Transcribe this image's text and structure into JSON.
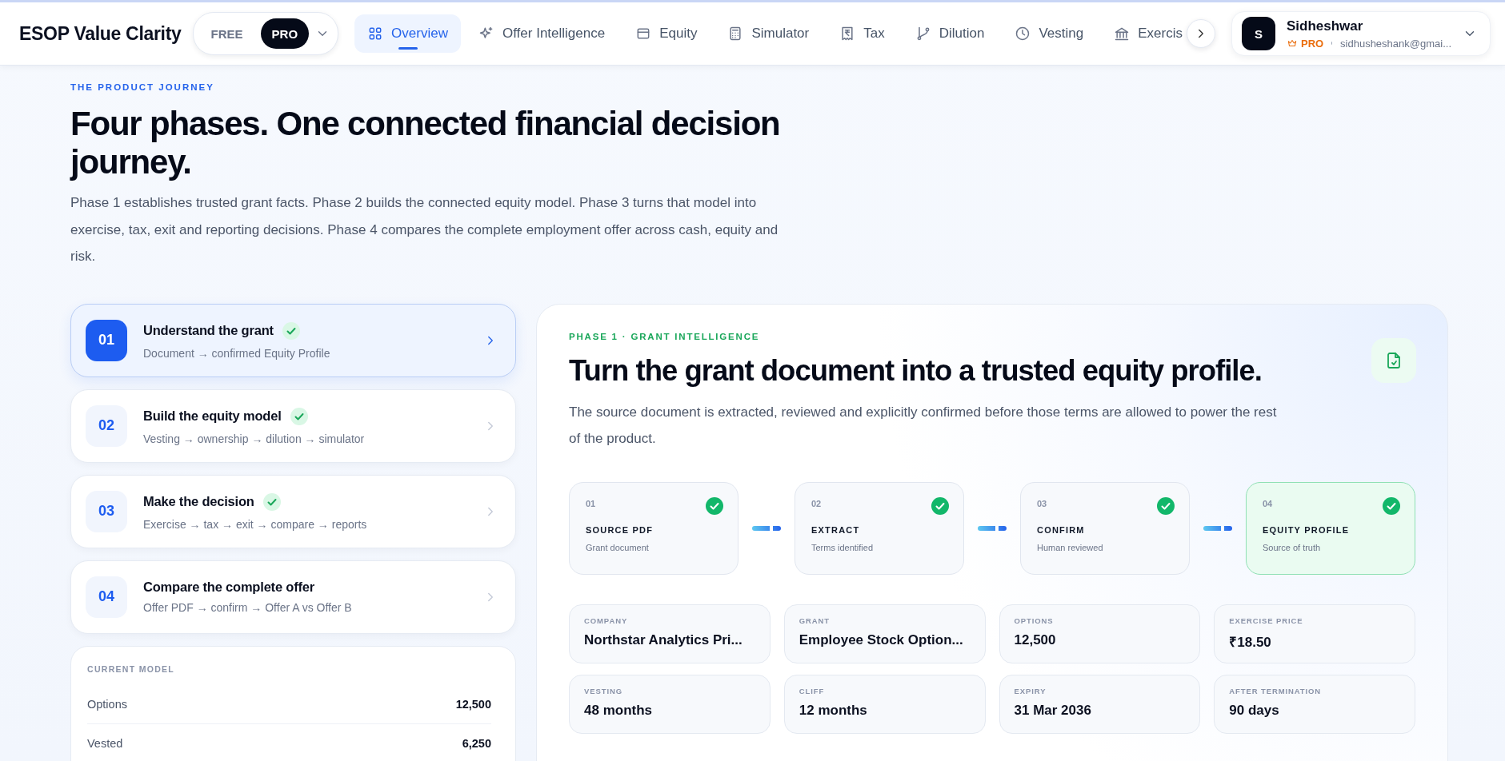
{
  "app": {
    "title": "ESOP Value Clarity"
  },
  "plan_toggle": {
    "options": [
      {
        "label": "FREE",
        "selected": false
      },
      {
        "label": "PRO",
        "selected": true
      }
    ]
  },
  "nav_tabs": [
    {
      "label": "Overview",
      "selected": true
    },
    {
      "label": "Offer Intelligence",
      "selected": false
    },
    {
      "label": "Equity",
      "selected": false
    },
    {
      "label": "Simulator",
      "selected": false
    },
    {
      "label": "Tax",
      "selected": false
    },
    {
      "label": "Dilution",
      "selected": false
    },
    {
      "label": "Vesting",
      "selected": false
    },
    {
      "label": "Exercis",
      "selected": false
    }
  ],
  "user": {
    "initial": "S",
    "name": "Sidheshwar",
    "plan": "PRO",
    "email": "sidhusheshank@gmai..."
  },
  "intro": {
    "eyebrow": "THE PRODUCT JOURNEY",
    "title": "Four phases. One connected financial decision journey.",
    "description": "Phase 1 establishes trusted grant facts. Phase 2 builds the connected equity model. Phase 3 turns that model into exercise, tax, exit and reporting decisions. Phase 4 compares the complete employment offer across cash, equity and risk."
  },
  "phases": [
    {
      "number": "01",
      "title": "Understand the grant",
      "steps": "Document → confirmed Equity Profile",
      "completed": true,
      "selected": true
    },
    {
      "number": "02",
      "title": "Build the equity model",
      "steps": "Vesting → ownership → dilution → simulator",
      "completed": true,
      "selected": false
    },
    {
      "number": "03",
      "title": "Make the decision",
      "steps": "Exercise → tax → exit → compare → reports",
      "completed": true,
      "selected": false
    },
    {
      "number": "04",
      "title": "Compare the complete offer",
      "steps": "Offer PDF → confirm → Offer A vs Offer B",
      "completed": false,
      "selected": false
    }
  ],
  "current_model": {
    "title": "CURRENT MODEL",
    "rows": [
      {
        "label": "Options",
        "value": "12,500"
      },
      {
        "label": "Vested",
        "value": "6,250"
      }
    ]
  },
  "phase_detail": {
    "eyebrow": "PHASE 1 · GRANT INTELLIGENCE",
    "title": "Turn the grant document into a trusted equity profile.",
    "description": "The source document is extracted, reviewed and explicitly confirmed before those terms are allowed to power the rest of the product.",
    "pipeline": [
      {
        "number": "01",
        "title": "SOURCE PDF",
        "subtitle": "Grant document",
        "done": true,
        "selected": false
      },
      {
        "number": "02",
        "title": "EXTRACT",
        "subtitle": "Terms identified",
        "done": true,
        "selected": false
      },
      {
        "number": "03",
        "title": "CONFIRM",
        "subtitle": "Human reviewed",
        "done": true,
        "selected": false
      },
      {
        "number": "04",
        "title": "EQUITY PROFILE",
        "subtitle": "Source of truth",
        "done": true,
        "selected": true
      }
    ],
    "facts": [
      {
        "label": "COMPANY",
        "value": "Northstar Analytics Pri..."
      },
      {
        "label": "GRANT",
        "value": "Employee Stock Option..."
      },
      {
        "label": "OPTIONS",
        "value": "12,500"
      },
      {
        "label": "EXERCISE PRICE",
        "value": "₹18.50"
      },
      {
        "label": "VESTING",
        "value": "48 months"
      },
      {
        "label": "CLIFF",
        "value": "12 months"
      },
      {
        "label": "EXPIRY",
        "value": "31 Mar 2036"
      },
      {
        "label": "AFTER TERMINATION",
        "value": "90 days"
      }
    ]
  }
}
